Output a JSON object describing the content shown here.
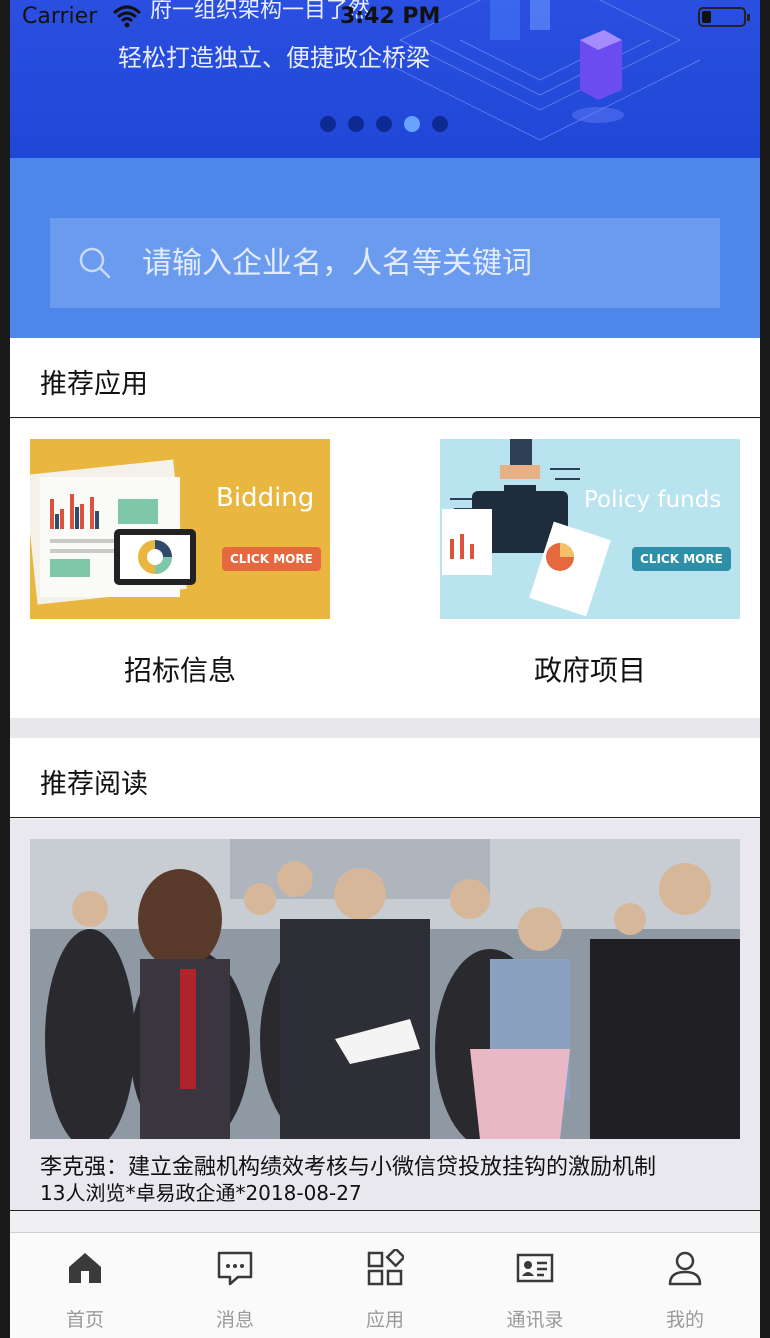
{
  "status_bar": {
    "carrier": "Carrier",
    "time": "3:42 PM"
  },
  "banner": {
    "title_partial": "府一组织架构一目了然",
    "subtitle": "轻松打造独立、便捷政企桥梁",
    "page_count": 5,
    "active_index": 3
  },
  "search": {
    "placeholder": "请输入企业名，人名等关键词"
  },
  "recommended_apps": {
    "header": "推荐应用",
    "items": [
      {
        "label": "招标信息",
        "image_text": "Bidding",
        "button_text": "CLICK MORE"
      },
      {
        "label": "政府项目",
        "image_text": "Policy funds",
        "button_text": "CLICK MORE"
      }
    ]
  },
  "recommended_reading": {
    "header": "推荐阅读",
    "articles": [
      {
        "title": "李克强：建立金融机构绩效考核与小微信贷投放挂钩的激励机制",
        "meta": "13人浏览*卓易政企通*2018-08-27"
      }
    ]
  },
  "tab_bar": {
    "items": [
      {
        "label": "首页",
        "icon": "home-icon",
        "active": true
      },
      {
        "label": "消息",
        "icon": "message-icon",
        "active": false
      },
      {
        "label": "应用",
        "icon": "apps-icon",
        "active": false
      },
      {
        "label": "通讯录",
        "icon": "contacts-icon",
        "active": false
      },
      {
        "label": "我的",
        "icon": "profile-icon",
        "active": false
      }
    ]
  },
  "colors": {
    "banner": "#1f47d6",
    "search_zone": "#4f86ea",
    "search_box": "#6b9bef",
    "tab_active": "#3a3a3a",
    "tab_inactive": "#9a9a9a"
  }
}
